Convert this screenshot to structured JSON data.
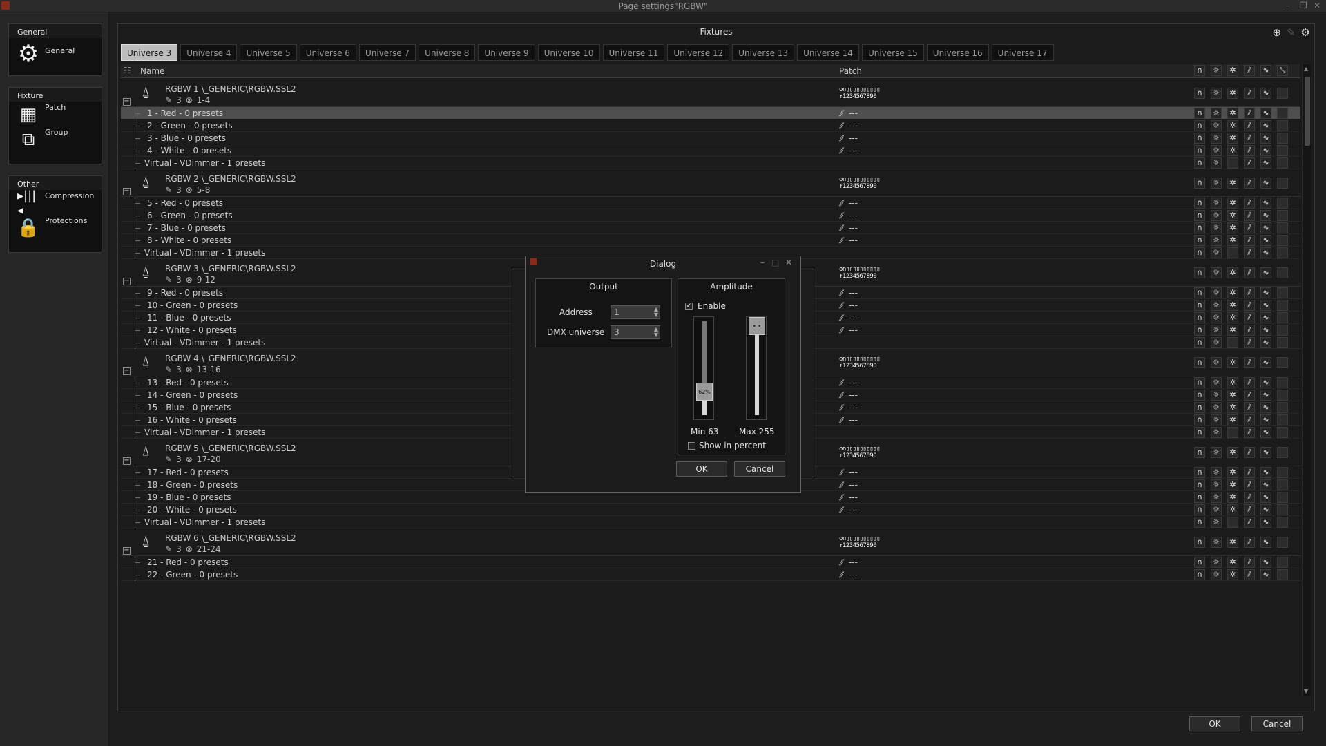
{
  "window": {
    "title": "Page settings\"RGBW\""
  },
  "sidebar": {
    "groups": [
      {
        "title": "General",
        "items": [
          {
            "label": "General",
            "icon": "gear-icon"
          }
        ]
      },
      {
        "title": "Fixture",
        "items": [
          {
            "label": "Patch",
            "icon": "patch-grid-icon"
          },
          {
            "label": "Group",
            "icon": "group-icon"
          }
        ]
      },
      {
        "title": "Other",
        "items": [
          {
            "label": "Compression",
            "icon": "compression-icon"
          },
          {
            "label": "Protections",
            "icon": "lock-icon"
          }
        ]
      }
    ]
  },
  "panel": {
    "title": "Fixtures",
    "tabs": [
      "Universe 3",
      "Universe 4",
      "Universe 5",
      "Universe 6",
      "Universe 7",
      "Universe 8",
      "Universe 9",
      "Universe 10",
      "Universe 11",
      "Universe 12",
      "Universe 13",
      "Universe 14",
      "Universe 15",
      "Universe 16",
      "Universe 17"
    ],
    "active_tab": "Universe 3",
    "columns": {
      "name": "Name",
      "patch": "Patch"
    },
    "patch_bits": "on▯▯▯▯▯▯▯▯▯▯",
    "patch_nums": "1234567890",
    "fixtures": [
      {
        "name": "RGBW  1   \\_GENERIC\\RGBW.SSL2",
        "universe": "3",
        "range": "1-4",
        "channels": [
          "1 - Red - 0 presets",
          "2 - Green - 0 presets",
          "3 - Blue - 0 presets",
          "4 - White - 0 presets",
          "Virtual - VDimmer - 1 presets"
        ]
      },
      {
        "name": "RGBW  2   \\_GENERIC\\RGBW.SSL2",
        "universe": "3",
        "range": "5-8",
        "channels": [
          "5 - Red - 0 presets",
          "6 - Green - 0 presets",
          "7 - Blue - 0 presets",
          "8 - White - 0 presets",
          "Virtual - VDimmer - 1 presets"
        ]
      },
      {
        "name": "RGBW  3   \\_GENERIC\\RGBW.SSL2",
        "universe": "3",
        "range": "9-12",
        "channels": [
          "9 - Red - 0 presets",
          "10 - Green - 0 presets",
          "11 - Blue - 0 presets",
          "12 - White - 0 presets",
          "Virtual - VDimmer - 1 presets"
        ]
      },
      {
        "name": "RGBW  4   \\_GENERIC\\RGBW.SSL2",
        "universe": "3",
        "range": "13-16",
        "channels": [
          "13 - Red - 0 presets",
          "14 - Green - 0 presets",
          "15 - Blue - 0 presets",
          "16 - White - 0 presets",
          "Virtual - VDimmer - 1 presets"
        ]
      },
      {
        "name": "RGBW  5   \\_GENERIC\\RGBW.SSL2",
        "universe": "3",
        "range": "17-20",
        "channels": [
          "17 - Red - 0 presets",
          "18 - Green - 0 presets",
          "19 - Blue - 0 presets",
          "20 - White - 0 presets",
          "Virtual - VDimmer - 1 presets"
        ]
      },
      {
        "name": "RGBW  6   \\_GENERIC\\RGBW.SSL2",
        "universe": "3",
        "range": "21-24",
        "channels": [
          "21 - Red - 0 presets",
          "22 - Green - 0 presets"
        ]
      }
    ],
    "channel_patch_text": "---",
    "row_icons": [
      "headphones-icon",
      "sun-icon",
      "gear-icon",
      "fader-icon",
      "wave-icon",
      "square-icon"
    ]
  },
  "footer": {
    "ok": "OK",
    "cancel": "Cancel"
  },
  "dialog": {
    "title": "Dialog",
    "output": {
      "title": "Output",
      "address_label": "Address",
      "address_value": "1",
      "universe_label": "DMX universe",
      "universe_value": "3"
    },
    "amplitude": {
      "title": "Amplitude",
      "enable_label": "Enable",
      "enable_checked": true,
      "min_label": "Min 63",
      "max_label": "Max 255",
      "min_knob": "62%",
      "min_level": 0.25,
      "max_level": 1.0,
      "percent_label": "Show in percent",
      "percent_checked": false
    },
    "ok": "OK",
    "cancel": "Cancel"
  }
}
